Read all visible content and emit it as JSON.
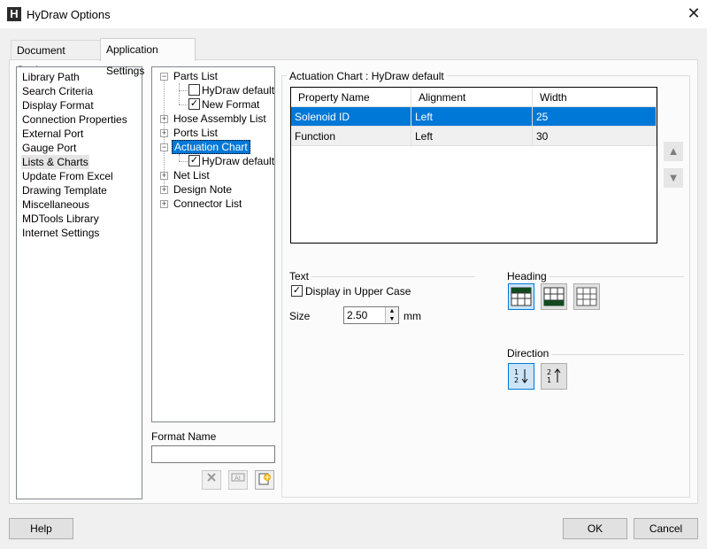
{
  "window": {
    "title": "HyDraw Options",
    "icon_letter": "H",
    "close_glyph": "✕"
  },
  "tabs": [
    {
      "label": "Document Settings"
    },
    {
      "label": "Application Settings"
    }
  ],
  "categories": [
    {
      "label": "Library Path"
    },
    {
      "label": "Search Criteria"
    },
    {
      "label": "Display Format"
    },
    {
      "label": "Connection Properties"
    },
    {
      "label": "External Port"
    },
    {
      "label": "Gauge Port"
    },
    {
      "label": "Lists & Charts"
    },
    {
      "label": "Update From Excel"
    },
    {
      "label": "Drawing Template"
    },
    {
      "label": "Miscellaneous"
    },
    {
      "label": "MDTools Library"
    },
    {
      "label": "Internet Settings"
    }
  ],
  "selected_category": "Lists & Charts",
  "tree": {
    "parts_list": {
      "label": "Parts List",
      "children": [
        {
          "label": "HyDraw default",
          "checked": false
        },
        {
          "label": "New Format",
          "checked": true
        }
      ]
    },
    "hose_assembly_list": {
      "label": "Hose Assembly List"
    },
    "ports_list": {
      "label": "Ports List"
    },
    "actuation_chart": {
      "label": "Actuation Chart",
      "children": [
        {
          "label": "HyDraw default",
          "checked": true
        }
      ]
    },
    "net_list": {
      "label": "Net List"
    },
    "design_note": {
      "label": "Design Note"
    },
    "connector_list": {
      "label": "Connector List"
    }
  },
  "format_name": {
    "label": "Format Name",
    "value": ""
  },
  "format_buttons": {
    "delete": "delete-icon",
    "rename": "rename-icon",
    "new": "new-format-icon"
  },
  "chart_group": {
    "title": "Actuation Chart : HyDraw default"
  },
  "grid": {
    "headers": [
      "Property Name",
      "Alignment",
      "Width"
    ],
    "rows": [
      {
        "name": "Solenoid ID",
        "alignment": "Left",
        "width": "25",
        "selected": true
      },
      {
        "name": "Function",
        "alignment": "Left",
        "width": "30",
        "selected": false
      }
    ]
  },
  "move_buttons": {
    "up": "▲",
    "down": "▼"
  },
  "text_group": {
    "title": "Text",
    "upper_case_label": "Display in Upper Case",
    "upper_case_checked": true,
    "size_label": "Size",
    "size_value": "2.50",
    "size_unit": "mm"
  },
  "heading_group": {
    "title": "Heading",
    "options": [
      "heading-top",
      "heading-bottom",
      "heading-none"
    ],
    "selected": "heading-top"
  },
  "direction_group": {
    "title": "Direction",
    "options": [
      "direction-down",
      "direction-up"
    ],
    "selected": "direction-down"
  },
  "buttons": {
    "help": "Help",
    "ok": "OK",
    "cancel": "Cancel"
  },
  "colors": {
    "accent": "#0078d7",
    "heading_fill": "#0d4d1e"
  }
}
